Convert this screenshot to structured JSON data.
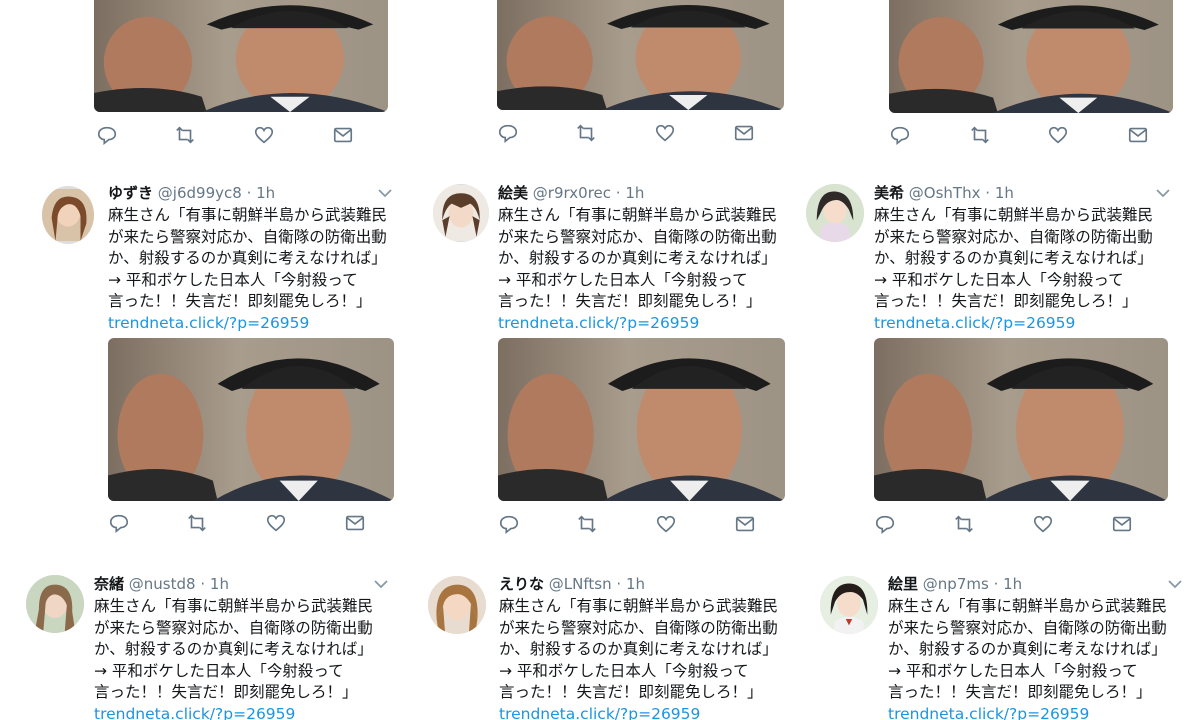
{
  "tweet_text": {
    "lines": [
      "麻生さん「有事に朝鮮半島から武装難民",
      "が来たら警察対応か、自衛隊の防衛出動",
      "か、射殺するのか真剣に考えなければ」",
      "→ 平和ボケした日本人「今射殺って",
      "言った！！失言だ！即刻罷免しろ！」"
    ],
    "link": "trendneta.click/?p=26959"
  },
  "colors": {
    "link": "#1b95e0",
    "muted": "#657786",
    "name": "#14171a"
  },
  "icons": [
    "reply-icon",
    "retweet-icon",
    "like-icon",
    "message-icon",
    "chevron-down-icon"
  ],
  "columns": [
    {
      "tweets": [
        {
          "name": "ゆずき",
          "handle": "@j6d99yc8",
          "sep": "·",
          "time": "1h"
        },
        {
          "name": "奈緒",
          "handle": "@nustd8",
          "sep": "·",
          "time": "1h"
        }
      ]
    },
    {
      "tweets": [
        {
          "name": "絵美",
          "handle": "@r9rx0rec",
          "sep": "·",
          "time": "1h"
        },
        {
          "name": "えりな",
          "handle": "@LNftsn",
          "sep": "·",
          "time": "1h"
        }
      ]
    },
    {
      "tweets": [
        {
          "name": "美希",
          "handle": "@OshThx",
          "sep": "·",
          "time": "1h"
        },
        {
          "name": "絵里",
          "handle": "@np7ms",
          "sep": "·",
          "time": "1h"
        }
      ]
    }
  ]
}
